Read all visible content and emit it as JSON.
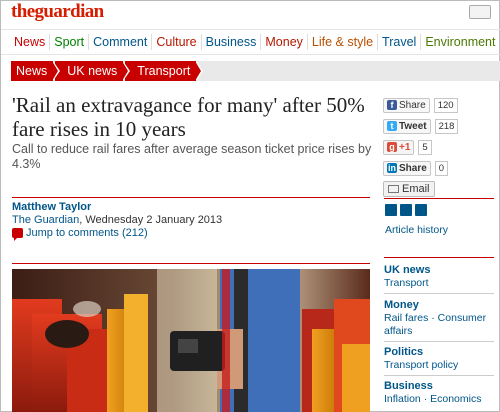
{
  "masthead": {
    "logo_the": "the",
    "logo_main": "guardian"
  },
  "nav": {
    "items": [
      {
        "label": "News",
        "color": "#c80000"
      },
      {
        "label": "Sport",
        "color": "#008000"
      },
      {
        "label": "Comment",
        "color": "#005689"
      },
      {
        "label": "Culture",
        "color": "#b51800"
      },
      {
        "label": "Business",
        "color": "#005689"
      },
      {
        "label": "Money",
        "color": "#b51800"
      },
      {
        "label": "Life & style",
        "color": "#b84f00"
      },
      {
        "label": "Travel",
        "color": "#005689"
      },
      {
        "label": "Environment",
        "color": "#4a7801"
      }
    ]
  },
  "breadcrumb": [
    "News",
    "UK news",
    "Transport"
  ],
  "article": {
    "headline": "'Rail an extravagance for many' after 50% fare rises in 10 years",
    "standfirst": "Call to reduce rail fares after average season ticket price rises by 4.3%",
    "author": "Matthew Taylor",
    "publication": "The Guardian",
    "date": ", Wednesday 2 January 2013",
    "comments_link": "Jump to comments (212)"
  },
  "share": {
    "facebook_label": "Share",
    "facebook_count": "120",
    "twitter_label": "Tweet",
    "twitter_count": "218",
    "gplus_label": "+1",
    "gplus_count": "5",
    "linkedin_label": "Share",
    "linkedin_count": "0",
    "email_label": "Email"
  },
  "article_tools": {
    "history_label": "Article history"
  },
  "related": [
    {
      "topic": "UK news",
      "subs": "Transport"
    },
    {
      "topic": "Money",
      "subs": "Rail fares · Consumer affairs"
    },
    {
      "topic": "Politics",
      "subs": "Transport policy"
    },
    {
      "topic": "Business",
      "subs": "Inflation · Economics"
    }
  ],
  "colors": {
    "accent": "#c80000",
    "link": "#005689"
  }
}
